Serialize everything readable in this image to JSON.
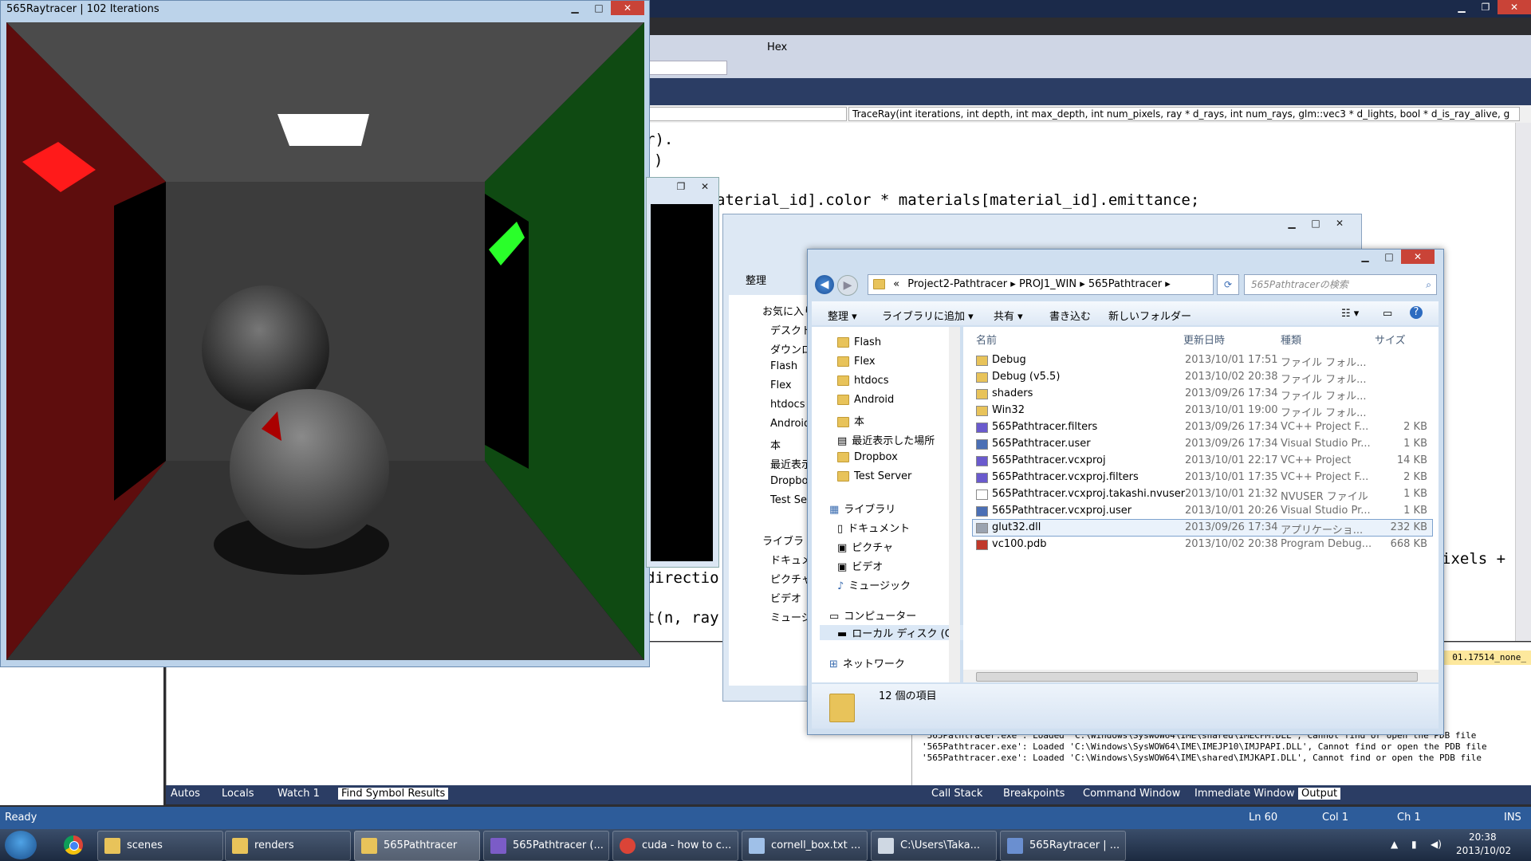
{
  "raytracer": {
    "title": "565Raytracer | 102 Iterations"
  },
  "vs": {
    "toolbar_hex": "Hex",
    "function_dropdown": "TraceRay(int iterations, int depth, int max_depth, int num_pixels, ray * d_rays, int num_rays, glm::vec3 * d_lights, bool * d_is_ray_alive, g",
    "code_lines": [
      {
        "text": "r)."
      },
      {
        "text": ")"
      },
      {
        "text": "aterial_id].color * materials[material_id].emittance;"
      },
      {
        "text": "ixels +"
      },
      {
        "text": "directio"
      },
      {
        "text": "t(n, ray"
      }
    ],
    "output_lines": [
      "'565Pathtracer.exe': Loaded 'C:\\Windows\\SysWOW64\\IME\\shared\\IMECFM.DLL', Cannot find or open the PDB file",
      "'565Pathtracer.exe': Loaded 'C:\\Windows\\SysWOW64\\IME\\IMEJP10\\IMJPAPI.DLL', Cannot find or open the PDB file",
      "'565Pathtracer.exe': Loaded 'C:\\Windows\\SysWOW64\\IME\\shared\\IMJKAPI.DLL', Cannot find or open the PDB file"
    ],
    "output_hdr_text": "01.17514_none_",
    "bottom_tabs": [
      "Autos",
      "Locals",
      "Watch 1",
      "Find Symbol Results"
    ],
    "right_tabs": [
      "Call Stack",
      "Breakpoints",
      "Command Window",
      "Immediate Window",
      "Output"
    ],
    "status": {
      "ready": "Ready",
      "ln": "Ln 60",
      "col": "Col 1",
      "ch": "Ch 1",
      "ins": "INS"
    }
  },
  "explorer_back": {
    "organize": "整理",
    "sidebar": [
      "お気に入り",
      "デスクト",
      "ダウンロ",
      "Flash",
      "Flex",
      "htdocs",
      "Android",
      "本",
      "最近表示",
      "Dropbox",
      "Test Se",
      "ライブラ",
      "ドキュメ",
      "ピクチャ",
      "ビデオ",
      "ミュージ"
    ]
  },
  "explorer": {
    "breadcrumb": [
      "«",
      "Project2-Pathtracer",
      "PROJ1_WIN",
      "565Pathtracer"
    ],
    "search_placeholder": "565Pathtracerの検索",
    "toolbar": [
      "整理",
      "ライブラリに追加",
      "共有",
      "書き込む",
      "新しいフォルダー"
    ],
    "nav": [
      {
        "label": "Flash"
      },
      {
        "label": "Flex"
      },
      {
        "label": "htdocs"
      },
      {
        "label": "Android"
      },
      {
        "label": "本"
      },
      {
        "label": "最近表示した場所"
      },
      {
        "label": "Dropbox"
      },
      {
        "label": "Test Server"
      },
      {
        "label": "ライブラリ"
      },
      {
        "label": "ドキュメント"
      },
      {
        "label": "ピクチャ"
      },
      {
        "label": "ビデオ"
      },
      {
        "label": "ミュージック"
      },
      {
        "label": "コンピューター"
      },
      {
        "label": "ローカル ディスク (C"
      },
      {
        "label": "ネットワーク"
      }
    ],
    "columns": {
      "name": "名前",
      "date": "更新日時",
      "type": "種類",
      "size": "サイズ"
    },
    "files": [
      {
        "name": "Debug",
        "date": "2013/10/01 17:51",
        "type": "ファイル フォル...",
        "size": "",
        "icon": "folder"
      },
      {
        "name": "Debug (v5.5)",
        "date": "2013/10/02 20:38",
        "type": "ファイル フォル...",
        "size": "",
        "icon": "folder"
      },
      {
        "name": "shaders",
        "date": "2013/09/26 17:34",
        "type": "ファイル フォル...",
        "size": "",
        "icon": "folder"
      },
      {
        "name": "Win32",
        "date": "2013/10/01 19:00",
        "type": "ファイル フォル...",
        "size": "",
        "icon": "folder"
      },
      {
        "name": "565Pathtracer.filters",
        "date": "2013/09/26 17:34",
        "type": "VC++ Project F...",
        "size": "2 KB",
        "icon": "vcproj"
      },
      {
        "name": "565Pathtracer.user",
        "date": "2013/09/26 17:34",
        "type": "Visual Studio Pr...",
        "size": "1 KB",
        "icon": "vsuser"
      },
      {
        "name": "565Pathtracer.vcxproj",
        "date": "2013/10/01 22:17",
        "type": "VC++ Project",
        "size": "14 KB",
        "icon": "vcproj"
      },
      {
        "name": "565Pathtracer.vcxproj.filters",
        "date": "2013/10/01 17:35",
        "type": "VC++ Project F...",
        "size": "2 KB",
        "icon": "vcproj"
      },
      {
        "name": "565Pathtracer.vcxproj.takashi.nvuser",
        "date": "2013/10/01 21:32",
        "type": "NVUSER ファイル",
        "size": "1 KB",
        "icon": "file"
      },
      {
        "name": "565Pathtracer.vcxproj.user",
        "date": "2013/10/01 20:26",
        "type": "Visual Studio Pr...",
        "size": "1 KB",
        "icon": "vsuser"
      },
      {
        "name": "glut32.dll",
        "date": "2013/09/26 17:34",
        "type": "アプリケーショ...",
        "size": "232 KB",
        "icon": "dll"
      },
      {
        "name": "vc100.pdb",
        "date": "2013/10/02 20:38",
        "type": "Program Debug...",
        "size": "668 KB",
        "icon": "pdb"
      }
    ],
    "item_count": "12 個の項目"
  },
  "taskbar": {
    "items": [
      {
        "label": "scenes",
        "icon": "folder-icon"
      },
      {
        "label": "renders",
        "icon": "folder-icon"
      },
      {
        "label": "565Pathtracer",
        "icon": "folder-icon"
      },
      {
        "label": "565Pathtracer (...",
        "icon": "visual-studio-icon"
      },
      {
        "label": "cuda - how to c...",
        "icon": "chrome-icon"
      },
      {
        "label": "cornell_box.txt ...",
        "icon": "notepad-icon"
      },
      {
        "label": "C:\\Users\\Taka...",
        "icon": "console-icon"
      },
      {
        "label": "565Raytracer | ...",
        "icon": "opengl-icon"
      }
    ],
    "time": "20:38",
    "date": "2013/10/02"
  }
}
